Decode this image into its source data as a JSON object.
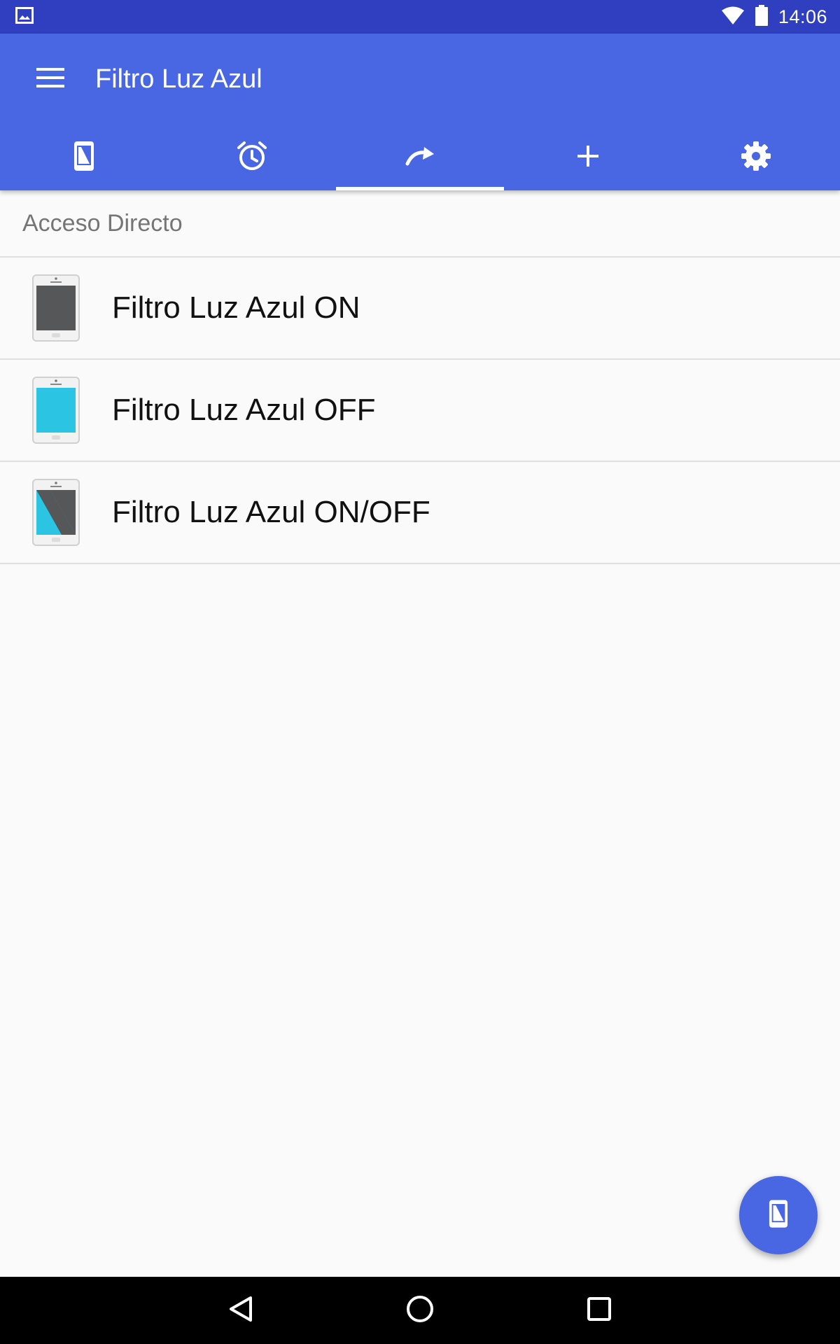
{
  "status_bar": {
    "time": "14:06",
    "left_icon": "image-notification-icon",
    "right_icons": [
      "wifi-icon",
      "battery-icon"
    ]
  },
  "app_bar": {
    "title": "Filtro Luz Azul",
    "menu_icon": "hamburger-menu-icon",
    "tabs": [
      {
        "icon": "phone-filter-icon",
        "active": false
      },
      {
        "icon": "alarm-clock-icon",
        "active": false
      },
      {
        "icon": "redo-arrow-icon",
        "active": true
      },
      {
        "icon": "plus-icon",
        "active": false
      },
      {
        "icon": "gear-icon",
        "active": false
      }
    ]
  },
  "section": {
    "title": "Acceso Directo"
  },
  "shortcuts": [
    {
      "label": "Filtro Luz Azul ON",
      "icon": "phone-dark-screen-icon"
    },
    {
      "label": "Filtro Luz Azul OFF",
      "icon": "phone-cyan-screen-icon"
    },
    {
      "label": "Filtro Luz Azul ON/OFF",
      "icon": "phone-split-screen-icon"
    }
  ],
  "fab": {
    "icon": "phone-filter-icon"
  },
  "nav_bar": {
    "icons": [
      "back-icon",
      "home-icon",
      "recents-icon"
    ]
  },
  "colors": {
    "status_bar": "#2f3fbf",
    "app_bar": "#4a67e3",
    "screen_dark": "#555759",
    "screen_cyan": "#2bc4e2"
  }
}
